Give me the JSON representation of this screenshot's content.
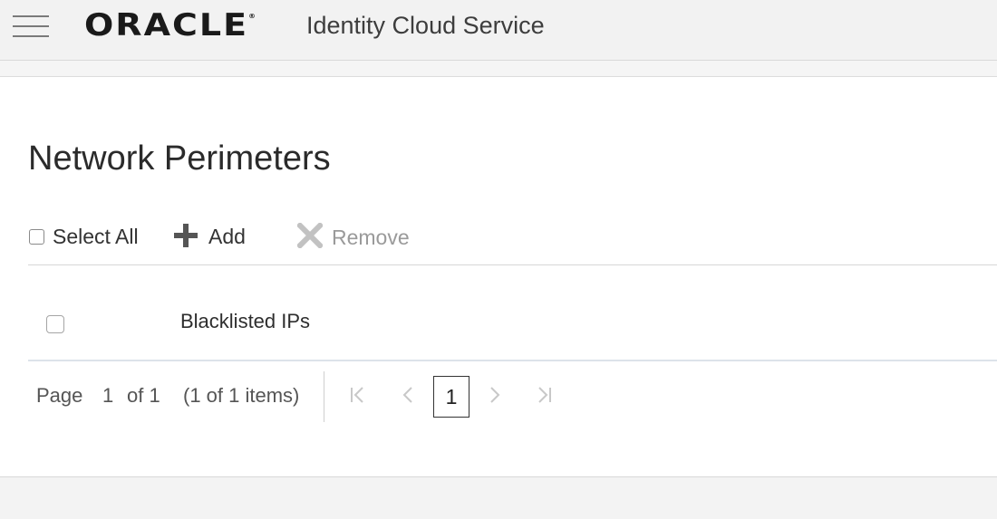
{
  "header": {
    "logo_text": "ORACLE",
    "logo_mark": "®",
    "app_title": "Identity Cloud Service",
    "menu_icon": "hamburger-menu-icon"
  },
  "page": {
    "title": "Network Perimeters"
  },
  "toolbar": {
    "select_all_label": "Select All",
    "add_label": "Add",
    "remove_label": "Remove",
    "add_icon": "plus-icon",
    "remove_icon": "x-icon"
  },
  "rows": [
    {
      "name": "Blacklisted IPs",
      "checked": false
    }
  ],
  "pagination": {
    "page_label": "Page",
    "current_page": "1",
    "of_total": "of 1",
    "items_summary": "(1 of 1 items)",
    "page_button": "1"
  },
  "colors": {
    "topbar_bg": "#f2f2f2",
    "text_primary": "#333333",
    "text_disabled": "#9a9a9a"
  }
}
